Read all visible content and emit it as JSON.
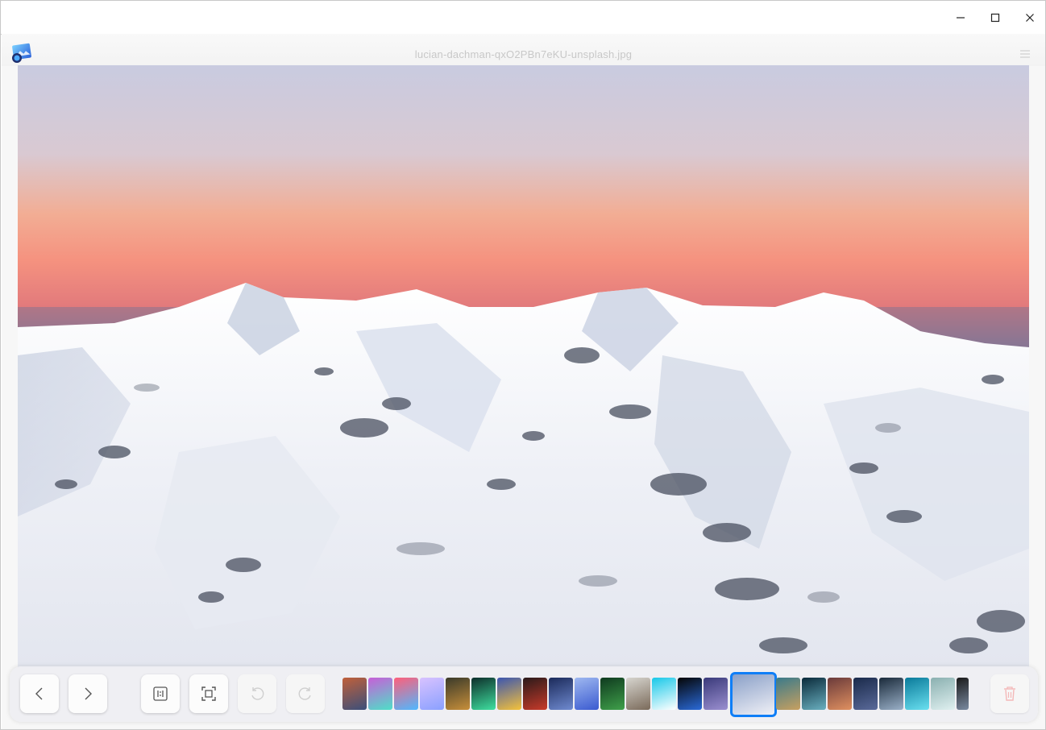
{
  "window": {
    "controls": {
      "minimize_icon": "minimize-icon",
      "maximize_icon": "maximize-icon",
      "close_icon": "close-icon"
    }
  },
  "viewer": {
    "file_name": "lucian-dachman-qxO2PBn7eKU-unsplash.jpg",
    "menu_icon": "hamburger-menu-icon",
    "accent_color": "#0f7ef7"
  },
  "toolbar": {
    "buttons": [
      {
        "name": "previous-button",
        "icon": "chevron-left-icon",
        "enabled": true
      },
      {
        "name": "next-button",
        "icon": "chevron-right-icon",
        "enabled": true
      },
      {
        "name": "original-size-button",
        "icon": "one-to-one-icon",
        "enabled": true
      },
      {
        "name": "fit-window-button",
        "icon": "fit-screen-icon",
        "enabled": true
      },
      {
        "name": "rotate-left-button",
        "icon": "rotate-ccw-icon",
        "enabled": false
      },
      {
        "name": "rotate-right-button",
        "icon": "rotate-cw-icon",
        "enabled": false
      },
      {
        "name": "delete-button",
        "icon": "trash-icon",
        "enabled": false
      }
    ],
    "thumbnails": [
      {
        "colors": [
          "#c0603a",
          "#3b4f7a"
        ]
      },
      {
        "colors": [
          "#c85fd8",
          "#4de0c8"
        ]
      },
      {
        "colors": [
          "#ff5f7a",
          "#4fb8ff"
        ]
      },
      {
        "colors": [
          "#d8c2ff",
          "#8aa0ff"
        ]
      },
      {
        "colors": [
          "#3a3a2a",
          "#c88f3a"
        ]
      },
      {
        "colors": [
          "#0d2e2a",
          "#3fe0a0"
        ]
      },
      {
        "colors": [
          "#3b55b0",
          "#f5c23a"
        ]
      },
      {
        "colors": [
          "#2a1a1a",
          "#c83a2a"
        ]
      },
      {
        "colors": [
          "#1b2a5a",
          "#6f8ad0"
        ]
      },
      {
        "colors": [
          "#9fb8f0",
          "#3a5ad0"
        ]
      },
      {
        "colors": [
          "#0f3a1f",
          "#3fa04a"
        ]
      },
      {
        "colors": [
          "#d7d5cf",
          "#7a6a5a"
        ]
      },
      {
        "colors": [
          "#18c8e8",
          "#ffffff"
        ]
      },
      {
        "colors": [
          "#050505",
          "#2a6ad8"
        ]
      },
      {
        "colors": [
          "#3a3a7a",
          "#9b8fd0"
        ]
      },
      {
        "colors": [
          "#8aa0c8",
          "#f0f0f6"
        ],
        "active": true
      },
      {
        "colors": [
          "#3a7a8a",
          "#c8a060"
        ]
      },
      {
        "colors": [
          "#0a2a3a",
          "#6ab0c0"
        ]
      },
      {
        "colors": [
          "#6a3a3a",
          "#e09060"
        ]
      },
      {
        "colors": [
          "#1a2a4a",
          "#5a6a9a"
        ]
      },
      {
        "colors": [
          "#1a2a3a",
          "#9ab0c8"
        ]
      },
      {
        "colors": [
          "#0a7a9a",
          "#6ae0f0"
        ]
      },
      {
        "colors": [
          "#8ab0b0",
          "#e0f0f0"
        ]
      },
      {
        "colors": [
          "#1a1a1a",
          "#7a8aa0"
        ]
      }
    ]
  }
}
